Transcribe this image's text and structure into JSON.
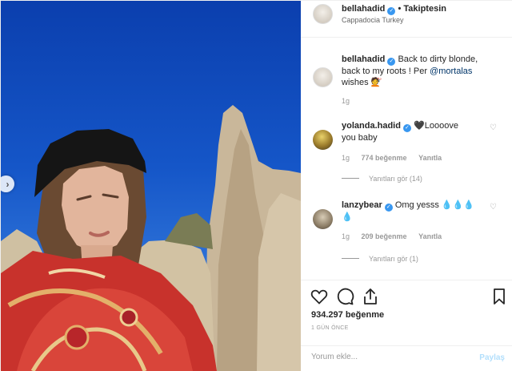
{
  "header": {
    "username": "bellahadid",
    "separator": "•",
    "follow_label": "Takiptesin",
    "location": "Cappadocia Turkey"
  },
  "caption": {
    "username": "bellahadid",
    "text_line1": "Back to dirty blonde,",
    "text_line2": "back to my roots ! Per",
    "mention": "@mortalas",
    "text_line3": "wishes",
    "emoji": "💇",
    "age": "1g"
  },
  "comments": [
    {
      "username": "yolanda.hadid",
      "text_line1": "🖤Loooove",
      "text_line2": "you baby",
      "age": "1g",
      "likes": "774 beğenme",
      "reply_label": "Yanıtla",
      "view_replies": "Yanıtları gör (14)"
    },
    {
      "username": "lanzybear",
      "text_line1": "Omg yesss 💧💧💧",
      "text_line2": "💧",
      "age": "1g",
      "likes": "209 beğenme",
      "reply_label": "Yanıtla",
      "view_replies": "Yanıtları gör (1)"
    }
  ],
  "actions": {
    "likes": "934.297 beğenme",
    "posted": "1 GÜN ÖNCE"
  },
  "comment_input": {
    "placeholder": "Yorum ekle...",
    "post_label": "Paylaş"
  },
  "colors": {
    "verified": "#3897f0",
    "link": "#003569",
    "muted": "#999999",
    "sky": "#1556c8"
  },
  "icons": [
    "next-arrow-icon",
    "verified-badge-icon",
    "heart-icon",
    "comment-icon",
    "share-icon",
    "bookmark-icon"
  ]
}
